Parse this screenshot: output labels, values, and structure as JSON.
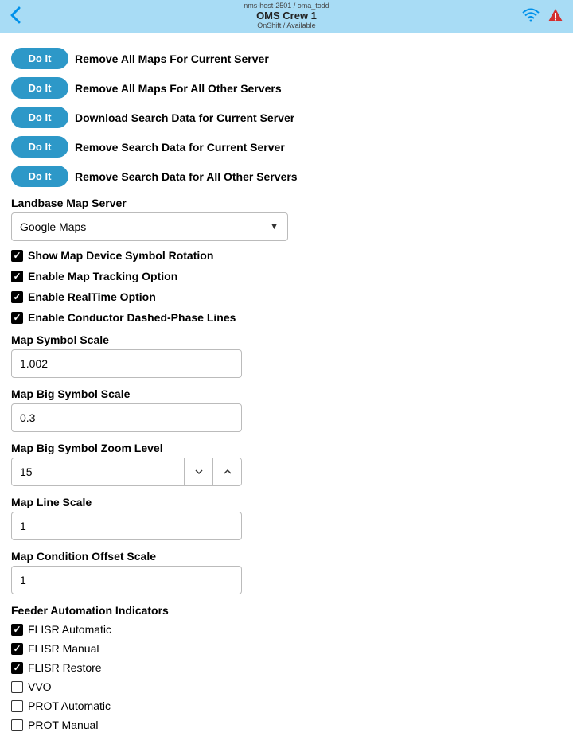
{
  "header": {
    "top": "nms-host-2501 / oma_todd",
    "title": "OMS Crew 1",
    "subtitle": "OnShift / Available"
  },
  "actions": [
    {
      "button": "Do It",
      "label": "Remove All Maps For Current Server"
    },
    {
      "button": "Do It",
      "label": "Remove All Maps For All Other Servers"
    },
    {
      "button": "Do It",
      "label": "Download Search Data for Current Server"
    },
    {
      "button": "Do It",
      "label": "Remove Search Data for Current Server"
    },
    {
      "button": "Do It",
      "label": "Remove Search Data for All Other Servers"
    }
  ],
  "landbase": {
    "label": "Landbase Map Server",
    "value": "Google Maps"
  },
  "toggles": [
    {
      "label": "Show Map Device Symbol Rotation",
      "checked": true
    },
    {
      "label": "Enable Map Tracking Option",
      "checked": true
    },
    {
      "label": "Enable RealTime Option",
      "checked": true
    },
    {
      "label": "Enable Conductor Dashed-Phase Lines",
      "checked": true
    }
  ],
  "fields": {
    "symbolScale": {
      "label": "Map Symbol Scale",
      "value": "1.002"
    },
    "bigSymbolScale": {
      "label": "Map Big Symbol Scale",
      "value": "0.3"
    },
    "bigSymbolZoom": {
      "label": "Map Big Symbol Zoom Level",
      "value": "15"
    },
    "lineScale": {
      "label": "Map Line Scale",
      "value": "1"
    },
    "conditionOffset": {
      "label": "Map Condition Offset Scale",
      "value": "1"
    }
  },
  "feeder": {
    "label": "Feeder Automation Indicators",
    "items": [
      {
        "label": "FLISR Automatic",
        "checked": true
      },
      {
        "label": "FLISR Manual",
        "checked": true
      },
      {
        "label": "FLISR Restore",
        "checked": true
      },
      {
        "label": "VVO",
        "checked": false
      },
      {
        "label": "PROT Automatic",
        "checked": false
      },
      {
        "label": "PROT Manual",
        "checked": false
      }
    ]
  }
}
